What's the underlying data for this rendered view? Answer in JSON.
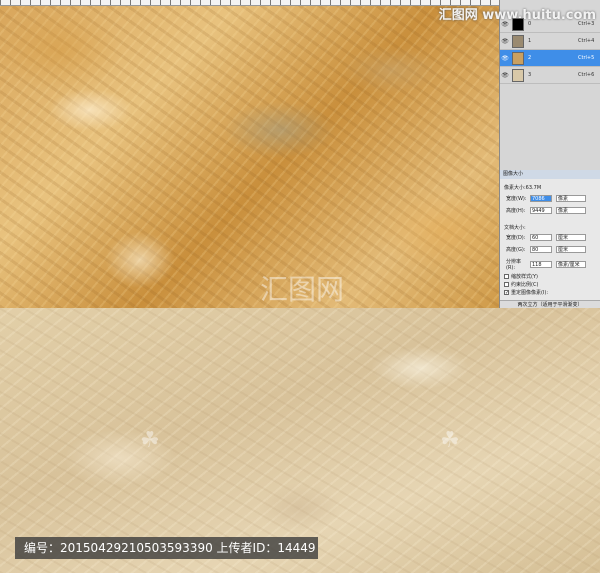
{
  "watermark": {
    "site": "汇图网 www.huitu.com",
    "logo_text": "汇图网",
    "caption_label": "编号：",
    "caption_id": "20150429210503593390",
    "uploader_label": " 上传者ID：",
    "uploader_id": "14449"
  },
  "layers_panel": {
    "layers": [
      {
        "name": "0",
        "shortcut": "Ctrl+3",
        "thumb": "#000000",
        "selected": false
      },
      {
        "name": "1",
        "shortcut": "Ctrl+4",
        "thumb": "#9a8a70",
        "selected": false
      },
      {
        "name": "2",
        "shortcut": "Ctrl+5",
        "thumb": "#c9a060",
        "selected": true
      },
      {
        "name": "3",
        "shortcut": "Ctrl+6",
        "thumb": "#d8c8a8",
        "selected": false
      }
    ]
  },
  "image_size_dialog": {
    "title": "图像大小",
    "pixel_dimensions_label": "像素大小:63.7M",
    "width_label": "宽度(W):",
    "width_value": "7086",
    "width_unit": "像素",
    "height_label": "高度(H):",
    "height_value": "9449",
    "height_unit": "像素",
    "doc_size_label": "文档大小:",
    "doc_width_label": "宽度(D):",
    "doc_width_value": "60",
    "doc_width_unit": "厘米",
    "doc_height_label": "高度(G):",
    "doc_height_value": "80",
    "doc_height_unit": "厘米",
    "resolution_label": "分辨率(R):",
    "resolution_value": "118",
    "resolution_unit": "像素/厘米",
    "scale_styles": "缩放样式(Y)",
    "constrain": "约束比例(C)",
    "resample": "重定图像像素(I):",
    "resample_method": "两次立方（适用于平滑渐变）"
  },
  "colors": {
    "selection_blue": "#3f8ee8"
  }
}
